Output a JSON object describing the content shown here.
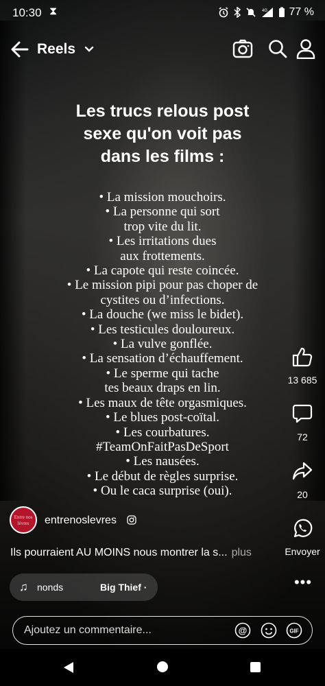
{
  "status_bar": {
    "time": "10:30",
    "battery": "77 %",
    "icons": [
      "hourglass-icon",
      "alarm-icon",
      "bluetooth-icon",
      "mute-icon",
      "signal-4g-icon",
      "battery-icon"
    ]
  },
  "header": {
    "title": "Reels"
  },
  "overlay": {
    "heading": [
      "Les trucs relous post",
      "sexe qu'on voit pas",
      "dans les films :"
    ],
    "items": [
      "• La mission mouchoirs.",
      "• La personne qui sort",
      "trop vite du lit.",
      "• Les irritations dues",
      "aux frottements.",
      "• La capote qui reste coincée.",
      "• Le mission pipi pour pas choper de",
      "cystites ou d’infections.",
      "• La douche (we miss le bidet).",
      "• Les testicules douloureux.",
      "• La vulve gonflée.",
      "• La sensation d’échauffement.",
      "• Le sperme qui tache",
      "tes beaux draps en lin.",
      "• Les maux de tête orgasmiques.",
      "• Le blues post-coïtal.",
      "• Les courbatures.",
      "#TeamOnFaitPasDeSport",
      "• Les nausées.",
      "• Le début de règles surprise.",
      "• Ou le caca surprise (oui)."
    ]
  },
  "actions": {
    "likes": "13 685",
    "comments": "72",
    "shares": "20",
    "send_label": "Envoyer"
  },
  "post": {
    "username": "entrenoslevres",
    "avatar_text": "Entre nos lèvres",
    "caption": "Ils pourraient AU MOINS nous montrer la s...",
    "more": "plus",
    "music_song": "nonds",
    "music_artist": "Big Thief ·"
  },
  "comment_bar": {
    "placeholder": "Ajoutez un commentaire..."
  }
}
